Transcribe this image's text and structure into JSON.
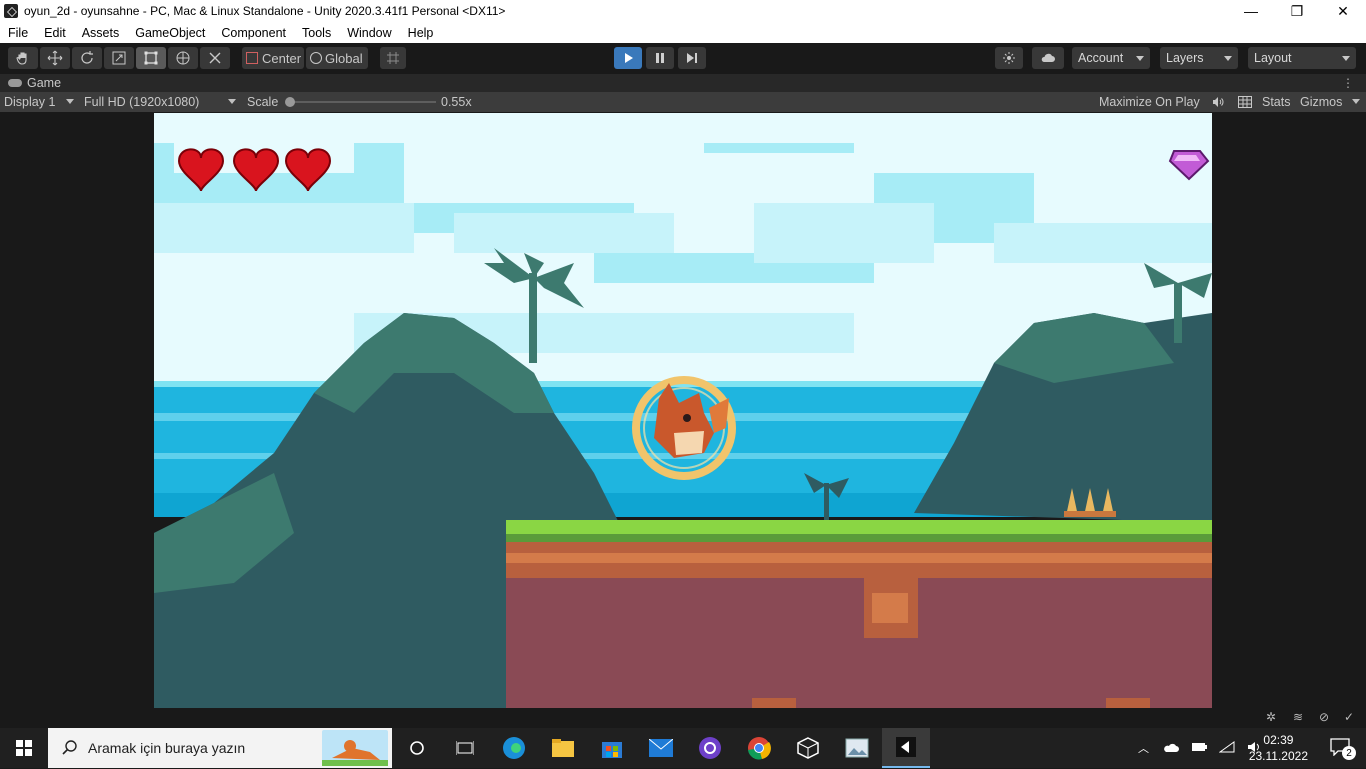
{
  "window": {
    "title": "oyun_2d - oyunsahne - PC, Mac & Linux Standalone - Unity 2020.3.41f1 Personal <DX11>",
    "controls": [
      "—",
      "❐",
      "✕"
    ]
  },
  "menu": [
    "File",
    "Edit",
    "Assets",
    "GameObject",
    "Component",
    "Tools",
    "Window",
    "Help"
  ],
  "toolbar": {
    "tools": [
      "hand-tool",
      "move-tool",
      "rotate-tool",
      "scale-tool",
      "rect-tool",
      "transform-tool",
      "custom-tool"
    ],
    "pivot_label": "Center",
    "space_label": "Global",
    "account_label": "Account",
    "layers_label": "Layers",
    "layout_label": "Layout"
  },
  "tab": {
    "label": "Game"
  },
  "gamebar": {
    "display": "Display 1",
    "resolution": "Full HD (1920x1080)",
    "scale_label": "Scale",
    "scale_value": "0.55x",
    "maximize_label": "Maximize On Play",
    "stats_label": "Stats",
    "gizmos_label": "Gizmos"
  },
  "game": {
    "hearts": 3,
    "gem_count": "1",
    "colors": {
      "sky": "#a7ecf6",
      "sea": "#1fb5df",
      "grass": "#8ad644",
      "dirt": "#8a4a55",
      "foliage": "#2f5b61"
    }
  },
  "taskbar": {
    "search_placeholder": "Aramak için buraya yazın",
    "time": "02:39",
    "date": "23.11.2022",
    "notification_count": "2",
    "pinned": [
      "cortana-icon",
      "task-view-icon",
      "edge-icon",
      "file-explorer-icon",
      "store-icon",
      "mail-icon",
      "github-icon",
      "chrome-icon",
      "unity-hub-icon",
      "photos-icon",
      "unity-icon"
    ]
  }
}
